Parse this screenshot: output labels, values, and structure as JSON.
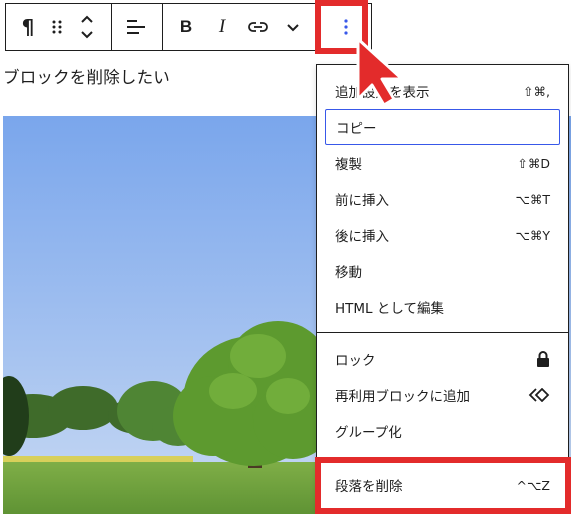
{
  "toolbar": {
    "paragraph_glyph": "¶",
    "bold_label": "B",
    "italic_label": "I",
    "icons": [
      "paragraph-icon",
      "drag-handle-icon",
      "move-up-down-icon",
      "align-left-icon",
      "bold-icon",
      "italic-icon",
      "link-icon",
      "chevron-down-icon",
      "more-options-icon"
    ]
  },
  "paragraph": {
    "text": "ブロックを削除したい"
  },
  "menu": {
    "group1": [
      {
        "label": "追加設定を表示",
        "shortcut": "⇧⌘,"
      },
      {
        "label": "コピー",
        "shortcut": ""
      },
      {
        "label": "複製",
        "shortcut": "⇧⌘D"
      },
      {
        "label": "前に挿入",
        "shortcut": "⌥⌘T"
      },
      {
        "label": "後に挿入",
        "shortcut": "⌥⌘Y"
      },
      {
        "label": "移動",
        "shortcut": ""
      },
      {
        "label": "HTML として編集",
        "shortcut": ""
      }
    ],
    "group2": [
      {
        "label": "ロック",
        "icon": "lock-icon"
      },
      {
        "label": "再利用ブロックに追加",
        "icon": "reusable-block-icon"
      },
      {
        "label": "グループ化"
      }
    ],
    "group3": [
      {
        "label": "段落を削除",
        "shortcut": "^⌥Z"
      }
    ]
  },
  "colors": {
    "highlight": "#e32b2b",
    "focus": "#3858e9",
    "border": "#1e1e1e"
  }
}
